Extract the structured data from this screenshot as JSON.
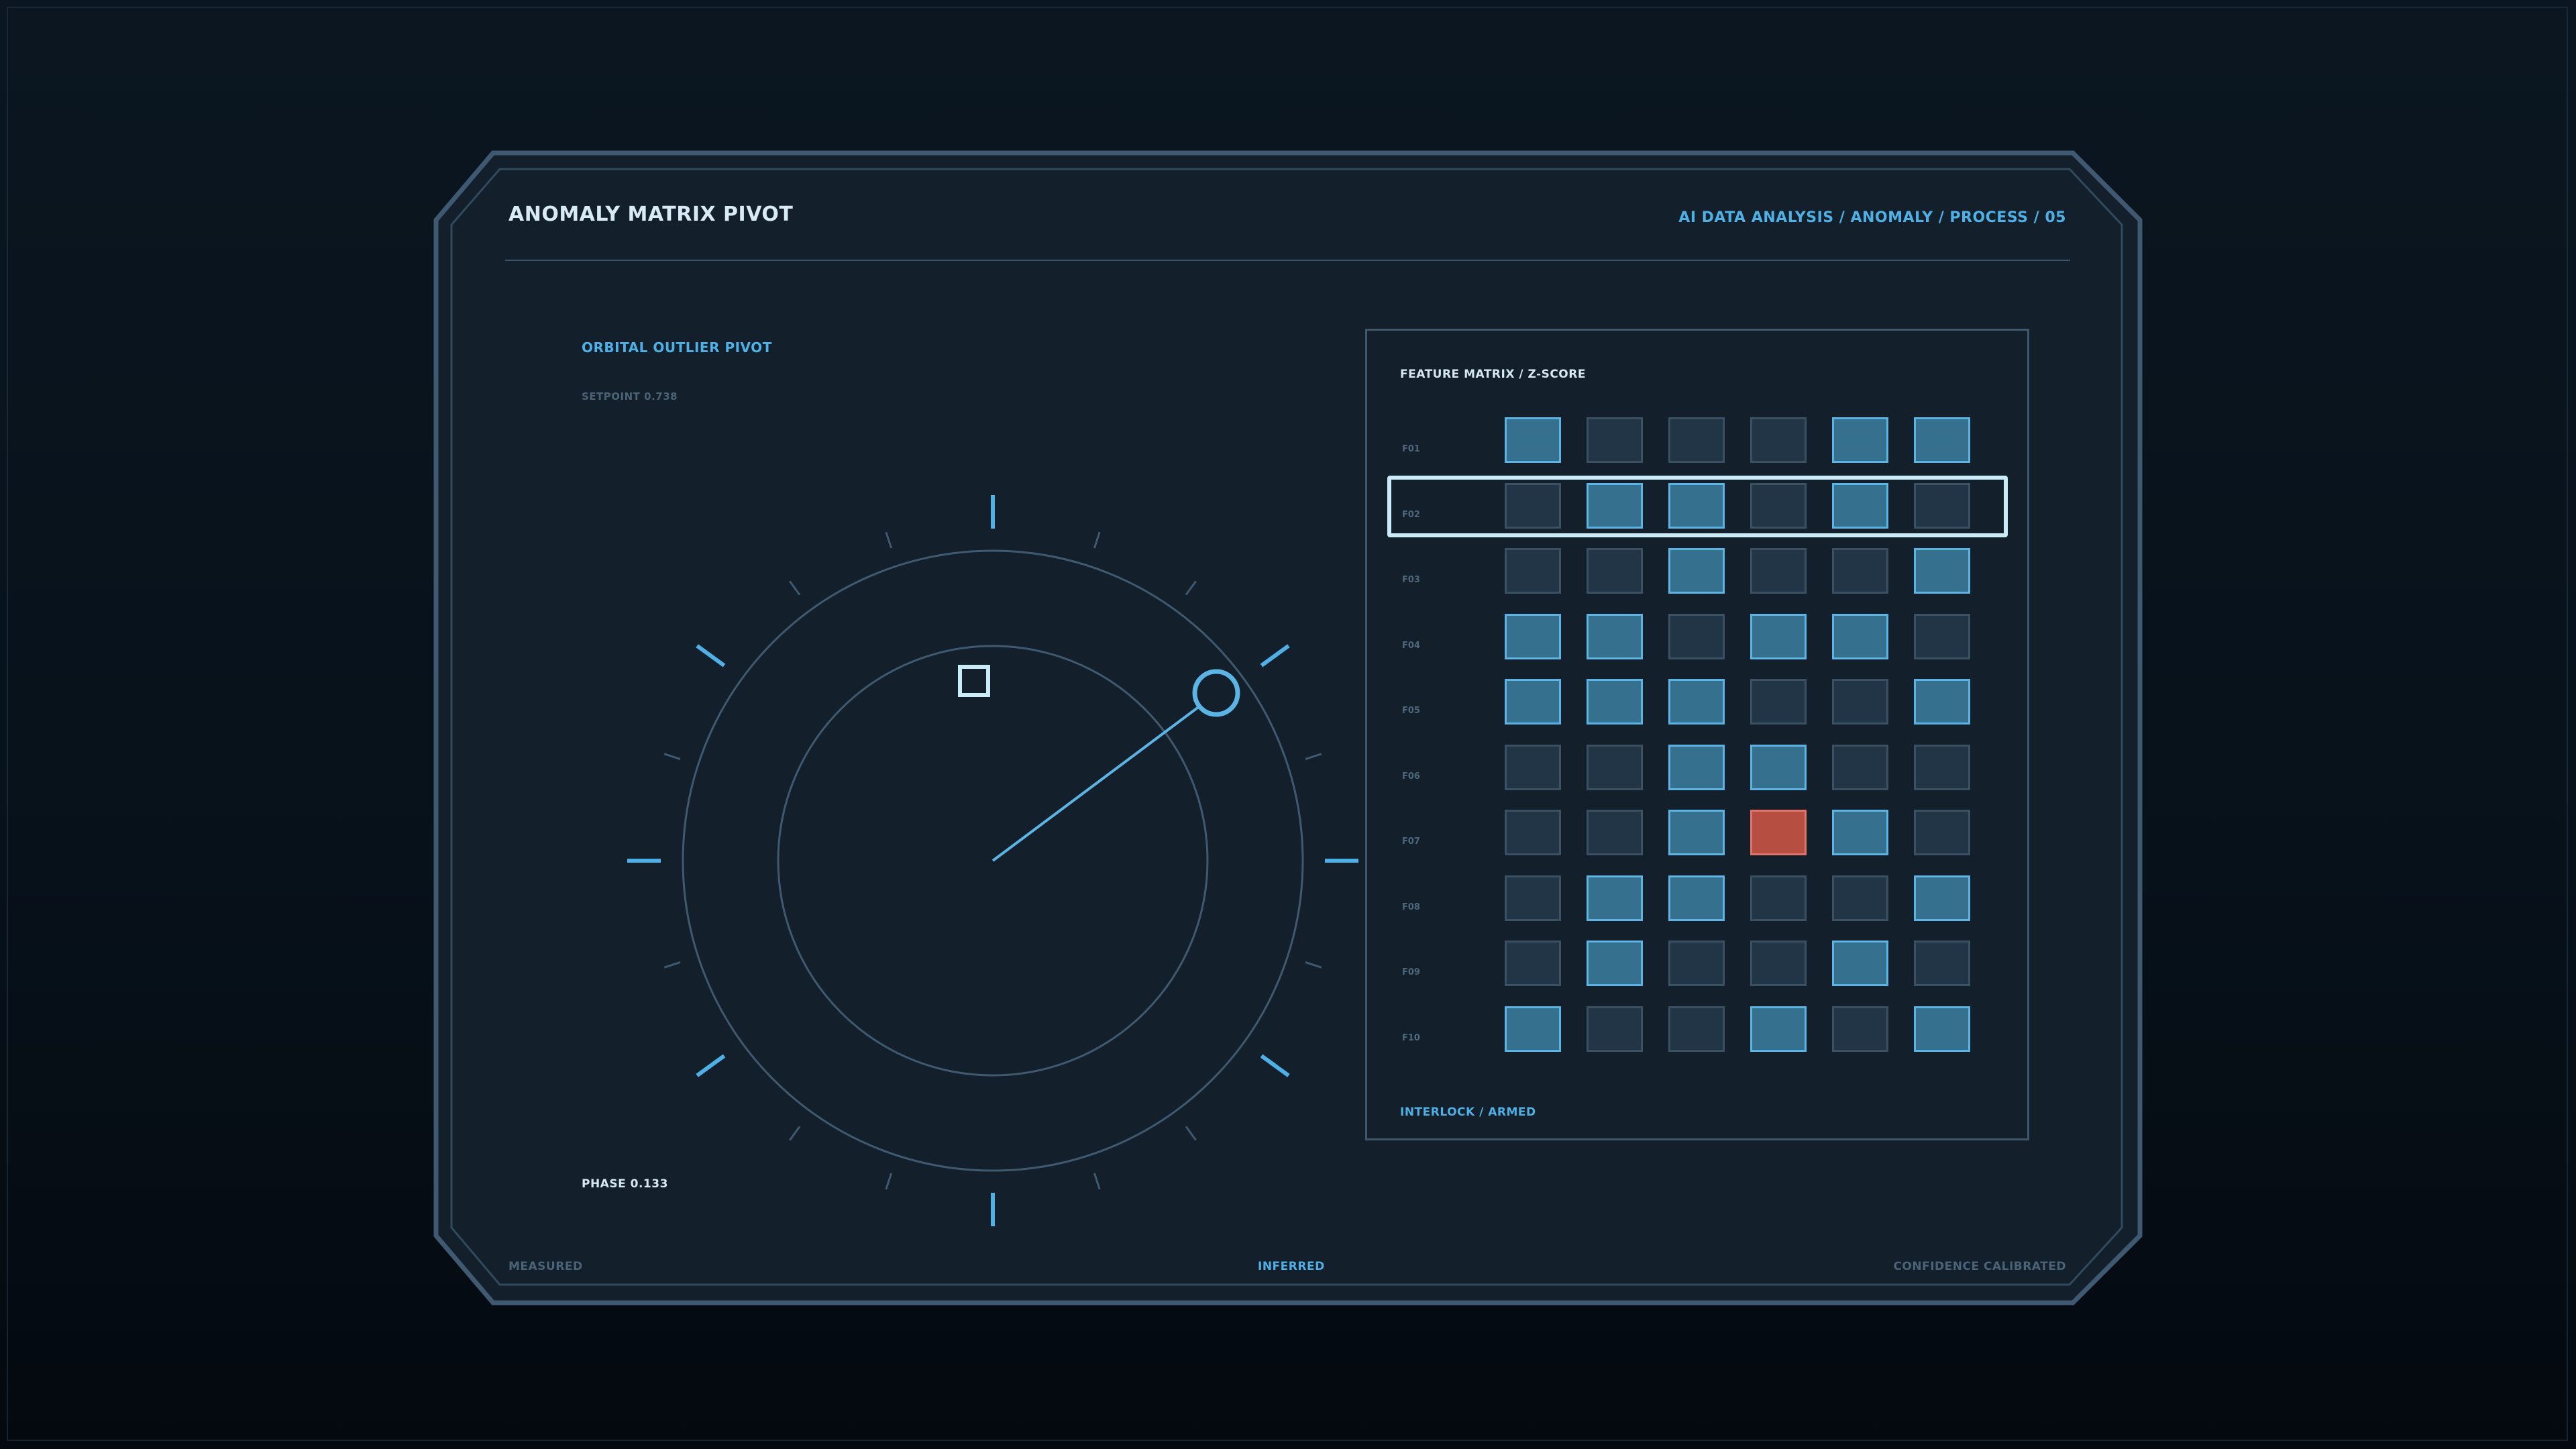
{
  "header": {
    "title": "ANOMALY MATRIX PIVOT",
    "breadcrumb": "AI DATA ANALYSIS / ANOMALY / PROCESS / 05"
  },
  "dial": {
    "title": "ORBITAL OUTLIER PIVOT",
    "setpoint": "SETPOINT 0.738",
    "phase": "PHASE 0.133"
  },
  "matrix": {
    "title": "FEATURE MATRIX / Z-SCORE",
    "footer": "INTERLOCK / ARMED",
    "selected_row": "F02",
    "rows": [
      {
        "label": "F01",
        "cells": [
          "on",
          "off",
          "off",
          "off",
          "on",
          "on"
        ]
      },
      {
        "label": "F02",
        "cells": [
          "off",
          "on",
          "on",
          "off",
          "on",
          "off"
        ]
      },
      {
        "label": "F03",
        "cells": [
          "off",
          "off",
          "on",
          "off",
          "off",
          "on"
        ]
      },
      {
        "label": "F04",
        "cells": [
          "on",
          "on",
          "off",
          "on",
          "on",
          "off"
        ]
      },
      {
        "label": "F05",
        "cells": [
          "on",
          "on",
          "on",
          "off",
          "off",
          "on"
        ]
      },
      {
        "label": "F06",
        "cells": [
          "off",
          "off",
          "on",
          "on",
          "off",
          "off"
        ]
      },
      {
        "label": "F07",
        "cells": [
          "off",
          "off",
          "on",
          "hot",
          "on",
          "off"
        ]
      },
      {
        "label": "F08",
        "cells": [
          "off",
          "on",
          "on",
          "off",
          "off",
          "on"
        ]
      },
      {
        "label": "F09",
        "cells": [
          "off",
          "on",
          "off",
          "off",
          "on",
          "off"
        ]
      },
      {
        "label": "F10",
        "cells": [
          "on",
          "off",
          "off",
          "on",
          "off",
          "on"
        ]
      }
    ]
  },
  "footer": {
    "left": "MEASURED",
    "center": "INFERRED",
    "right": "CONFIDENCE CALIBRATED"
  },
  "colors": {
    "accent": "#4fb0e6",
    "panel_bg": "#131f2b",
    "cell_on": "#36708f",
    "cell_off": "#223546",
    "anomaly": "#b64e42"
  }
}
